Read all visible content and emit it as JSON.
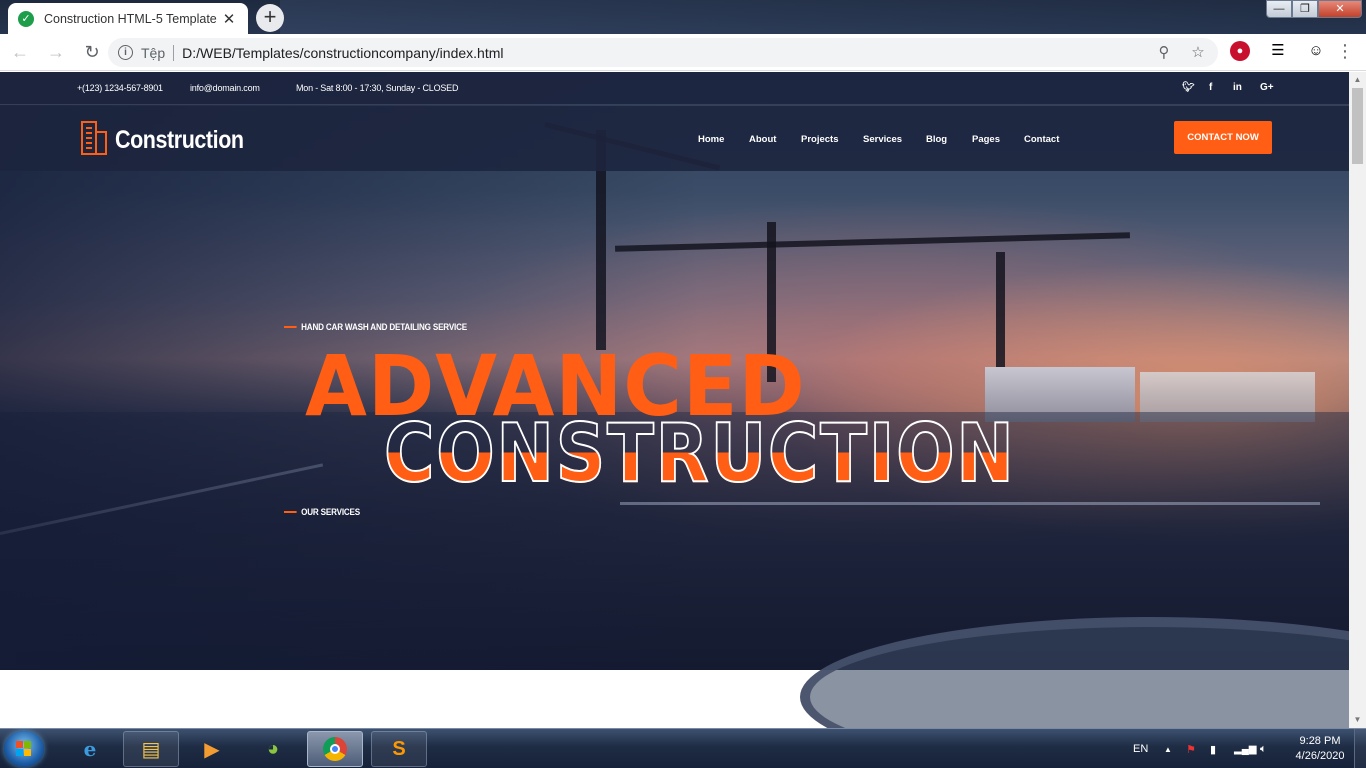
{
  "browser": {
    "tab_title": "Construction HTML-5 Template",
    "tab_close": "✕",
    "new_tab": "+",
    "site_label": "Tệp",
    "url": "D:/WEB/Templates/constructioncompany/index.html",
    "window_controls": {
      "minimize": "—",
      "restore": "❐",
      "close": "✕"
    }
  },
  "site": {
    "topbar": {
      "phone": "+(123) 1234-567-8901",
      "email": "info@domain.com",
      "hours": "Mon - Sat 8:00 - 17:30, Sunday - CLOSED",
      "social": [
        "twitter-icon",
        "facebook-icon",
        "linkedin-icon",
        "google-plus-icon"
      ]
    },
    "logo": "Construction",
    "nav": [
      "Home",
      "About",
      "Projects",
      "Services",
      "Blog",
      "Pages",
      "Contact"
    ],
    "contact_button": "CONTACT NOW",
    "hero": {
      "eyebrow": "HAND CAR WASH AND DETAILING SERVICE",
      "title_line1": "ADVANCED",
      "title_line2": "CONSTRUCTION",
      "link": "OUR SERVICES"
    },
    "accent_color": "#ff5e14",
    "dark_color": "#1c243e"
  },
  "taskbar": {
    "pinned": [
      "internet-explorer-icon",
      "file-explorer-icon",
      "media-player-icon",
      "green-app-icon",
      "chrome-icon",
      "sublime-text-icon"
    ],
    "language": "EN",
    "time": "9:28 PM",
    "date": "4/26/2020"
  }
}
